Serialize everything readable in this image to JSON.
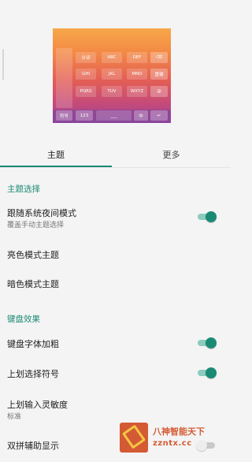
{
  "preview": {
    "keys": {
      "comma": "分词",
      "k2": "ABC",
      "k3": "DEF",
      "del": "⌫",
      "k4": "GHI",
      "k5": "JKL",
      "k6": "MNO",
      "clear": "重输",
      "k7": "PQRS",
      "k8": "TUV",
      "k9": "WXYZ",
      "at": "@",
      "sym": "符号",
      "num": "123",
      "space": "___",
      "zhen": "中",
      "enter": "↵"
    }
  },
  "tabs": [
    {
      "label": "主题",
      "active": true
    },
    {
      "label": "更多",
      "active": false
    }
  ],
  "sections": [
    {
      "header": "主题选择",
      "items": [
        {
          "title": "跟随系统夜间模式",
          "subtitle": "覆盖手动主题选择",
          "toggle": true
        },
        {
          "title": "亮色模式主题"
        },
        {
          "title": "暗色模式主题"
        }
      ]
    },
    {
      "header": "键盘效果",
      "items": [
        {
          "title": "键盘字体加粗",
          "toggle": true
        },
        {
          "title": "上划选择符号",
          "toggle": true
        },
        {
          "title": "上划输入灵敏度",
          "subtitle": "标准"
        },
        {
          "title": "双拼辅助显示",
          "toggle": false
        }
      ]
    }
  ],
  "watermark": {
    "name": "八神智能天下",
    "domain": "zzntx.cc"
  },
  "colors": {
    "accent": "#1b8a74",
    "accent_track": "#8ccbbd"
  }
}
